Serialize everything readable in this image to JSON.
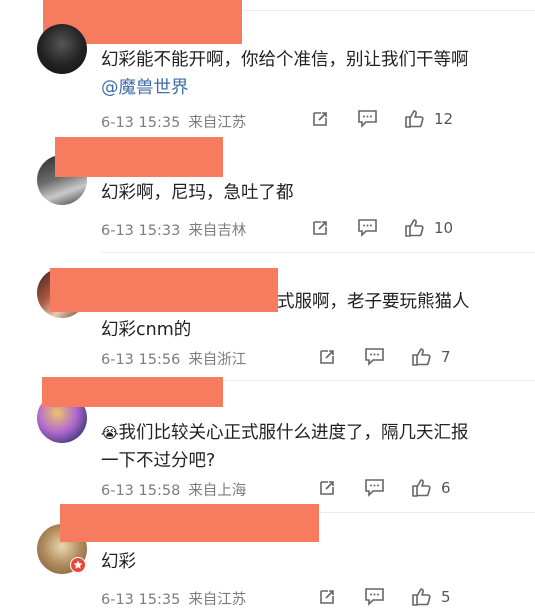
{
  "comments": [
    {
      "text": "幻彩能不能开啊，你给个准信，别让我们干等啊",
      "mention": "@魔兽世界",
      "time": "6-13 15:35",
      "location": "来自江苏",
      "likes": "12"
    },
    {
      "text": "幻彩啊，尼玛，急吐了都",
      "mention": "",
      "time": "6-13 15:33",
      "location": "来自吉林",
      "likes": "10"
    },
    {
      "text": "式服啊，老子要玩熊猫人幻彩cnm的",
      "mention": "",
      "time": "6-13 15:56",
      "location": "来自浙江",
      "likes": "7"
    },
    {
      "text": "我们比较关心正式服什么进度了，隔几天汇报一下不过分吧?",
      "mention": "",
      "emoji": "😭",
      "time": "6-13 15:58",
      "location": "来自上海",
      "likes": "6"
    },
    {
      "text": "幻彩",
      "mention": "",
      "time": "6-13 15:35",
      "location": "来自江苏",
      "likes": "5"
    }
  ],
  "colors": {
    "redaction": "#f77c5f",
    "mention": "#3d6ea8",
    "meta": "#7d7d7d"
  },
  "icons": [
    "share-icon",
    "comment-icon",
    "thumbs-up-icon"
  ]
}
